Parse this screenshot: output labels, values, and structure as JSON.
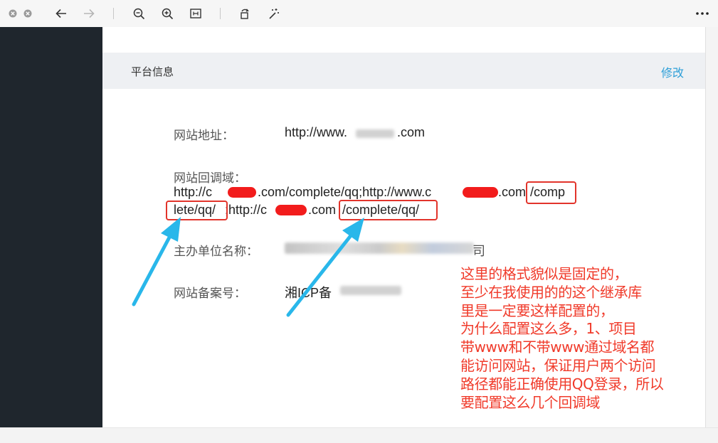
{
  "toolbar": {
    "icons": [
      "close-icon",
      "minimize-icon",
      "back-icon",
      "forward-icon",
      "zoom-out-icon",
      "zoom-in-icon",
      "fit-icon",
      "rotate-icon",
      "magic-wand-icon",
      "more-icon"
    ]
  },
  "panel": {
    "title": "平台信息",
    "edit_label": "修改"
  },
  "fields": {
    "website_label": "网站地址：",
    "website_prefix": "http://www.",
    "website_suffix": ".com",
    "callback_label": "网站回调域：",
    "callback_line1_a": "http://c",
    "callback_line1_b": ".com/complete/qq;http://www.c",
    "callback_line1_c": ".com",
    "callback_line1_d": "/comp",
    "callback_line2_a": "lete/qq/",
    "callback_line2_b": ";http://c",
    "callback_line2_c": ".com",
    "callback_line2_d": "/complete/qq/",
    "organizer_label": "主办单位名称：",
    "organizer_value_visible": "司",
    "icp_label": "网站备案号：",
    "icp_value_visible": "湘ICP备"
  },
  "annotation": {
    "text": "这里的格式貌似是固定的，\n至少在我使用的的这个继承库\n里是一定要这样配置的，\n为什么配置这么多，1、项目\n带www和不带www通过域名都\n能访问网站，保证用户两个访问\n路径都能正确使用QQ登录，所以\n要配置这么几个回调域"
  },
  "colors": {
    "sidebar": "#1f262d",
    "header_bg": "#eef0f3",
    "link": "#2d9fd8",
    "annotation": "#f03a2a",
    "arrow": "#29b7ea"
  }
}
